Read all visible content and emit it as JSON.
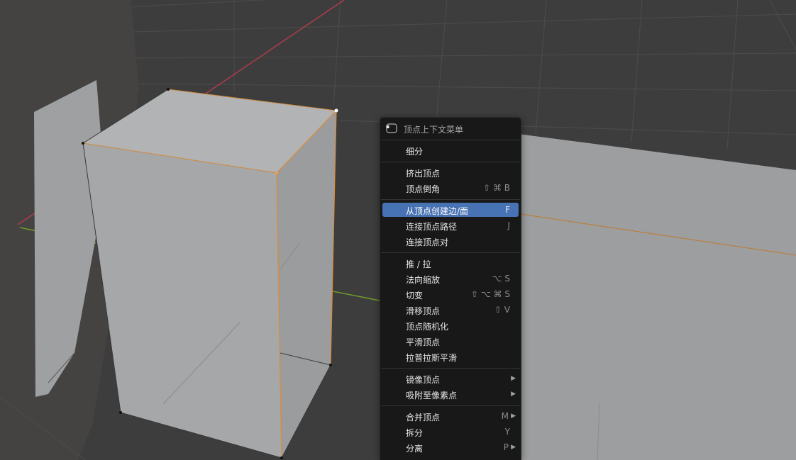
{
  "colors": {
    "viewport_bg": "#3d3d3d",
    "grid_line": "#4b4b4b",
    "x_axis": "#b03c4c",
    "y_axis": "#6f9a2a",
    "mesh_face": "#9fa1a2",
    "selected_edge": "#e08a30",
    "menu_bg": "#181818",
    "menu_highlight": "#4772b3"
  },
  "menu": {
    "header": {
      "icon": "vertex-select-icon",
      "title": "顶点上下文菜单"
    },
    "items": [
      {
        "label": "细分",
        "shortcut": ""
      },
      {
        "label": "挤出顶点",
        "shortcut": ""
      },
      {
        "label": "顶点倒角",
        "shortcut": "⇧ ⌘ B"
      },
      {
        "label": "从顶点创建边/面",
        "shortcut": "F",
        "active": true
      },
      {
        "label": "连接顶点路径",
        "shortcut": "J"
      },
      {
        "label": "连接顶点对",
        "shortcut": ""
      },
      {
        "label": "推 / 拉",
        "shortcut": ""
      },
      {
        "label": "法向缩放",
        "shortcut": "⌥ S"
      },
      {
        "label": "切变",
        "shortcut": "⇧ ⌥ ⌘ S"
      },
      {
        "label": "滑移顶点",
        "shortcut": "⇧ V"
      },
      {
        "label": "顶点随机化",
        "shortcut": ""
      },
      {
        "label": "平滑顶点",
        "shortcut": ""
      },
      {
        "label": "拉普拉斯平滑",
        "shortcut": ""
      },
      {
        "label": "镜像顶点",
        "shortcut": "",
        "submenu": true
      },
      {
        "label": "吸附至像素点",
        "shortcut": "",
        "submenu": true
      },
      {
        "label": "合并顶点",
        "shortcut": "M",
        "submenu": true
      },
      {
        "label": "拆分",
        "shortcut": "Y"
      },
      {
        "label": "分离",
        "shortcut": "P",
        "submenu": true
      }
    ]
  }
}
